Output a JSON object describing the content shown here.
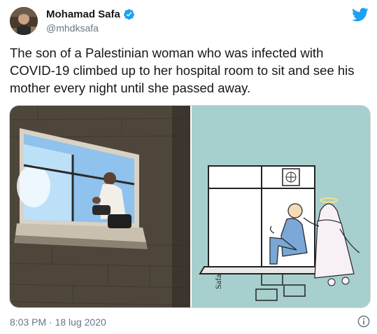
{
  "user": {
    "display_name": "Mohamad Safa",
    "handle": "@mhdksafa"
  },
  "tweet": {
    "text": "The son of a Palestinian woman who was infected with COVID-19 climbed up to her hospital room to sit and see his mother every night until she passed away."
  },
  "media": {
    "left_photo": "photo",
    "right_photo": "illustration",
    "signature": "Safa"
  },
  "meta": {
    "time": "8:03 PM",
    "separator": "·",
    "date": "18 lug 2020"
  },
  "colors": {
    "brand": "#1da1f2",
    "text_primary": "#14171a",
    "text_secondary": "#657786",
    "illustration_bg": "#a7cfcd"
  },
  "icons": {
    "verified": "verified-badge-icon",
    "brand": "twitter-bird-icon",
    "info": "info-icon"
  }
}
